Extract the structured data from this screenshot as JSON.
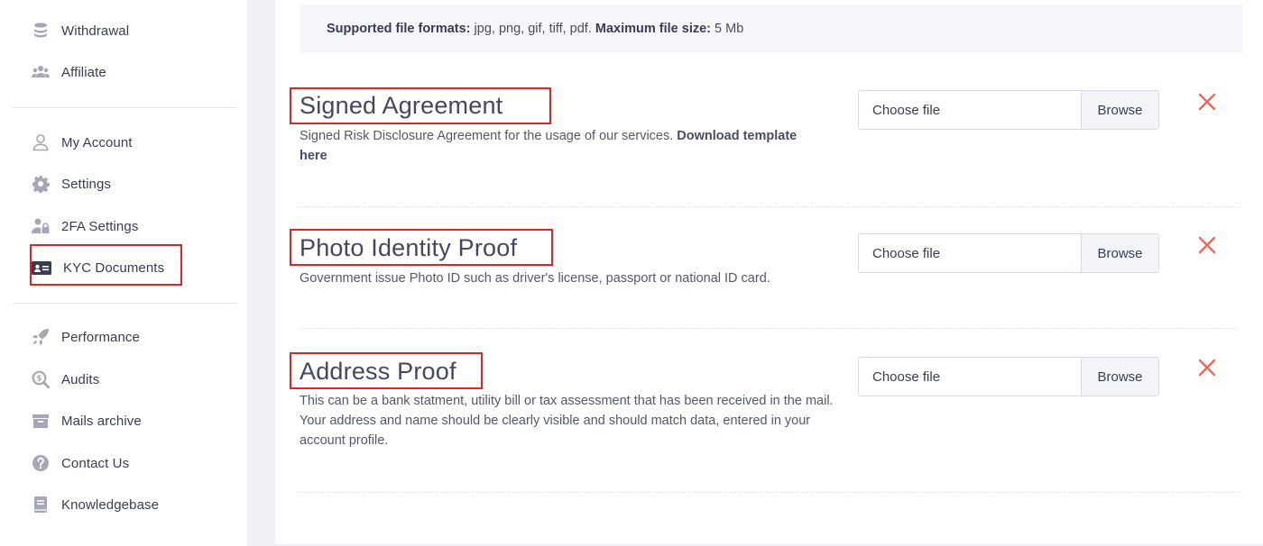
{
  "sidebar": {
    "items": [
      {
        "label": "Withdrawal",
        "icon": "coins-stack-icon"
      },
      {
        "label": "Affiliate",
        "icon": "users-group-icon"
      },
      {
        "label": "My Account",
        "icon": "user-icon"
      },
      {
        "label": "Settings",
        "icon": "gear-icon"
      },
      {
        "label": "2FA Settings",
        "icon": "user-lock-icon"
      },
      {
        "label": "KYC Documents",
        "icon": "id-card-icon"
      },
      {
        "label": "Performance",
        "icon": "rocket-icon"
      },
      {
        "label": "Audits",
        "icon": "search-dollar-icon"
      },
      {
        "label": "Mails archive",
        "icon": "archive-box-icon"
      },
      {
        "label": "Contact Us",
        "icon": "question-circle-icon"
      },
      {
        "label": "Knowledgebase",
        "icon": "book-icon"
      }
    ],
    "active": "KYC Documents"
  },
  "notice": {
    "formats_label": "Supported file formats:",
    "formats_value": " jpg, png, gif, tiff, pdf. ",
    "size_label": "Maximum file size:",
    "size_value": " 5 Mb"
  },
  "documents": [
    {
      "title": "Signed Agreement",
      "description": "Signed Risk Disclosure Agreement for the usage of our services. ",
      "link_text": "Download template here",
      "file_placeholder": "Choose file",
      "browse_label": "Browse"
    },
    {
      "title": "Photo Identity Proof",
      "description": "Government issue Photo ID such as driver's license, passport or national ID card.",
      "file_placeholder": "Choose file",
      "browse_label": "Browse"
    },
    {
      "title": "Address Proof",
      "description": "This can be a bank statment, utility bill or tax assessment that has been received in the mail. Your address and name should be clearly visible and should match data, entered in your account profile.",
      "file_placeholder": "Choose file",
      "browse_label": "Browse"
    }
  ],
  "colors": {
    "highlight_box": "#d9262a",
    "remove_icon": "#e8685c",
    "icon_gray": "#a5a8b4"
  }
}
